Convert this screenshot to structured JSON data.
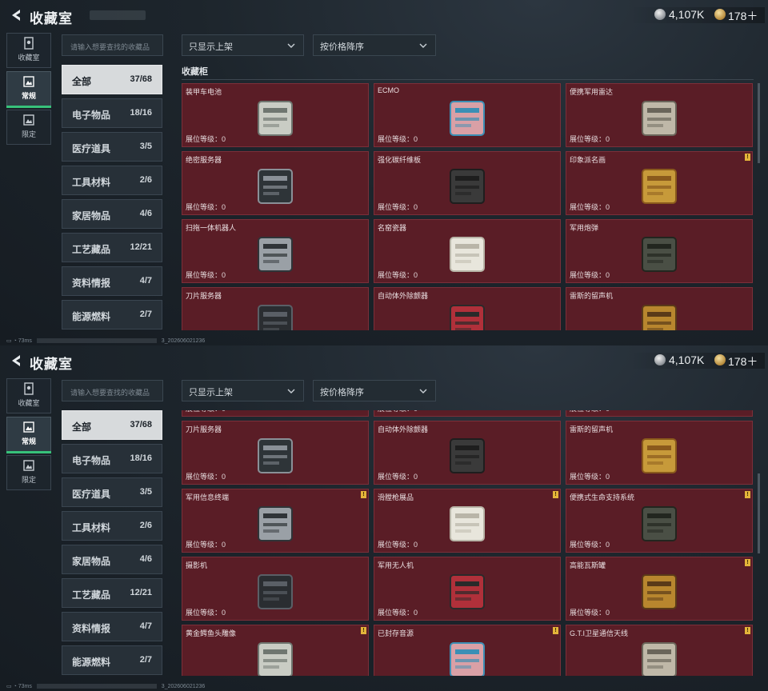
{
  "header": {
    "title": "收藏室",
    "silver_amount": "4,107K",
    "gold_amount": "178＋"
  },
  "left_tabs": [
    {
      "label": "收藏室",
      "icon": "collection-room-icon"
    },
    {
      "label": "常规",
      "icon": "regular-icon"
    },
    {
      "label": "限定",
      "icon": "limited-icon"
    }
  ],
  "search": {
    "placeholder": "请输入想要查找的收藏品"
  },
  "filters": {
    "shelf_filter": "只显示上架",
    "sort": "按价格降序"
  },
  "categories": [
    {
      "label": "全部",
      "count": "37/68"
    },
    {
      "label": "电子物品",
      "count": "18/16"
    },
    {
      "label": "医疗道具",
      "count": "3/5"
    },
    {
      "label": "工具材料",
      "count": "2/6"
    },
    {
      "label": "家居物品",
      "count": "4/6"
    },
    {
      "label": "工艺藏品",
      "count": "12/21"
    },
    {
      "label": "资料情报",
      "count": "4/7"
    },
    {
      "label": "能源燃料",
      "count": "2/7"
    }
  ],
  "section_title": "收藏柜",
  "level_label": "展位等级：0",
  "status_bar": {
    "ping": "73ms",
    "build_suffix": "3_202606021236"
  },
  "screen1_items": [
    {
      "name": "装甲车电池",
      "warn": false
    },
    {
      "name": "ECMO",
      "warn": false
    },
    {
      "name": "便携军用雷达",
      "warn": false
    },
    {
      "name": "绝密服务器",
      "warn": false
    },
    {
      "name": "强化碳纤维板",
      "warn": false
    },
    {
      "name": "印象派名画",
      "warn": true
    },
    {
      "name": "扫拖一体机器人",
      "warn": false
    },
    {
      "name": "名窑瓷器",
      "warn": false
    },
    {
      "name": "军用炮弹",
      "warn": false
    },
    {
      "name": "刀片服务器",
      "warn": false
    },
    {
      "name": "自动体外除颤器",
      "warn": false
    },
    {
      "name": "雷斯的留声机",
      "warn": false
    }
  ],
  "screen2_items": [
    {
      "name": "",
      "warn": false
    },
    {
      "name": "",
      "warn": false
    },
    {
      "name": "",
      "warn": false
    },
    {
      "name": "刀片服务器",
      "warn": false
    },
    {
      "name": "自动体外除颤器",
      "warn": false
    },
    {
      "name": "雷斯的留声机",
      "warn": false
    },
    {
      "name": "军用信息终端",
      "warn": true
    },
    {
      "name": "滑膛枪展品",
      "warn": true
    },
    {
      "name": "便携式生命支持系统",
      "warn": true
    },
    {
      "name": "摄影机",
      "warn": false
    },
    {
      "name": "军用无人机",
      "warn": false
    },
    {
      "name": "高能瓦斯罐",
      "warn": true
    },
    {
      "name": "黄金鳄鱼头雕像",
      "warn": true
    },
    {
      "name": "已封存音源",
      "warn": true
    },
    {
      "name": "G.T.I卫星通信天线",
      "warn": true
    }
  ]
}
